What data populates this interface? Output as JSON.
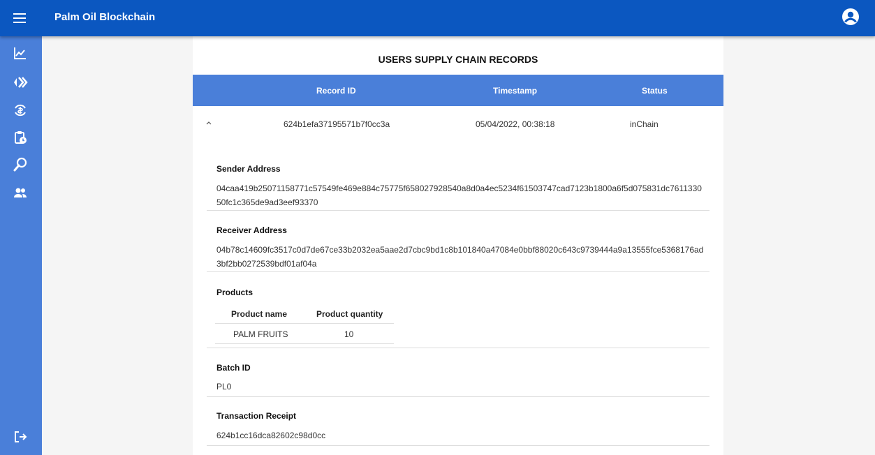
{
  "header": {
    "title": "Palm Oil Blockchain",
    "menu_icon": "hamburger-icon",
    "account_icon": "account-circle-icon",
    "bar_color": "#0b57c0"
  },
  "sidebar": {
    "color": "#4a7fd9",
    "items": [
      {
        "icon": "chart-icon"
      },
      {
        "icon": "double-chevron-icon"
      },
      {
        "icon": "currency-exchange-icon"
      },
      {
        "icon": "clipboard-clock-icon"
      },
      {
        "icon": "search-icon"
      },
      {
        "icon": "group-icon"
      }
    ],
    "logout_icon": "logout-icon"
  },
  "page": {
    "title": "USERS SUPPLY CHAIN RECORDS",
    "columns": [
      "Record ID",
      "Timestamp",
      "Status"
    ],
    "record": {
      "id": "624b1efa37195571b7f0cc3a",
      "timestamp": "05/04/2022, 00:38:18",
      "status": "inChain",
      "expanded": true
    },
    "details": {
      "sender_label": "Sender Address",
      "sender_value": "04caa419b25071158771c57549fe469e884c75775f658027928540a8d0a4ec5234f61503747cad7123b1800a6f5d075831dc7611330 50fc1c365de9ad3eef93370",
      "receiver_label": "Receiver Address",
      "receiver_value": "04b78c14609fc3517c0d7de67ce33b2032ea5aae2d7cbc9bd1c8b101840a47084e0bbf88020c643c9739444a9a13555fce5368176ad 3bf2bb0272539bdf01af04a",
      "products_label": "Products",
      "product_columns": [
        "Product name",
        "Product quantity"
      ],
      "products": [
        {
          "name": "PALM FRUITS",
          "quantity": "10"
        }
      ],
      "batch_label": "Batch ID",
      "batch_value": "PL0",
      "receipt_label": "Transaction Receipt",
      "receipt_value": "624b1cc16dca82602c98d0cc"
    }
  }
}
